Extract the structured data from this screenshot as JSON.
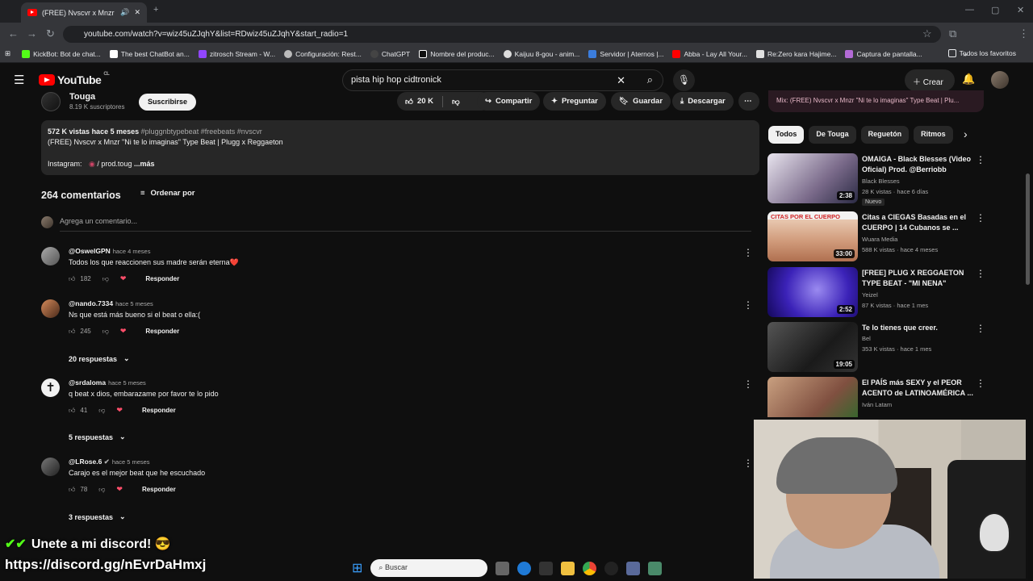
{
  "browser": {
    "tab_title": "(FREE) Nvscvr x Mnzr \"Ni te",
    "url": "youtube.com/watch?v=wiz45uZJqhY&list=RDwiz45uZJqhY&start_radio=1",
    "bookmarks": [
      "KickBot: Bot de chat...",
      "The best ChatBot an...",
      "zitrosch Stream - W...",
      "Configuración: Rest...",
      "ChatGPT",
      "Nombre del produc...",
      "Kaijuu 8-gou - anim...",
      "Servidor | Aternos |...",
      "Abba - Lay All Your...",
      "Re:Zero kara Hajime...",
      "Captura de pantalla..."
    ],
    "all_bookmarks": "Todos los favoritos"
  },
  "header": {
    "logo": "YouTube",
    "country": "CL",
    "search_value": "pista hip hop cidtronick",
    "create": "Crear"
  },
  "channel": {
    "name": "Touga",
    "subscribers": "8.19 K suscriptores",
    "subscribe": "Suscribirse"
  },
  "actions": {
    "likes": "20 K",
    "share": "Compartir",
    "ask": "Preguntar",
    "save": "Guardar",
    "download": "Descargar"
  },
  "description": {
    "views": "572 K vistas",
    "age": "hace 5 meses",
    "tags": "#pluggnbtypebeat #freebeats #nvscvr",
    "title": "(FREE) Nvscvr x Mnzr \"Ni te lo imaginas\" Type Beat | Plugg x Reggaeton",
    "instagram_label": "Instagram:",
    "instagram_value": "/ prod.toug",
    "more": "...más"
  },
  "comments": {
    "count": "264 comentarios",
    "sort": "Ordenar por",
    "add_placeholder": "Agrega un comentario...",
    "reply_label": "Responder",
    "items": [
      {
        "user": "@OswelGPN",
        "time": "hace 4 meses",
        "text": "Todos los que reaccionen sus madre serán eterna❤️",
        "likes": "182"
      },
      {
        "user": "@nando.7334",
        "time": "hace 5 meses",
        "text": "Ns que está más bueno si el beat o ella:(",
        "likes": "245",
        "replies": "20 respuestas"
      },
      {
        "user": "@srdaloma",
        "time": "hace 5 meses",
        "text": "q beat x dios, embarazame por favor te lo pido",
        "likes": "41",
        "replies": "5 respuestas"
      },
      {
        "user": "@LRose.6",
        "time": "hace 5 meses",
        "text": "Carajo es el mejor beat que he escuchado",
        "likes": "78",
        "replies": "3 respuestas"
      }
    ]
  },
  "sidebar": {
    "mix": "Mix: (FREE) Nvscvr x Mnzr \"Ni te lo imaginas\" Type Beat | Plu...",
    "chips": [
      "Todos",
      "De Touga",
      "Reguetón",
      "Ritmos"
    ],
    "videos": [
      {
        "title": "OMAIGA - Black Blesses (Video Oficial) Prod. @Berriobb",
        "channel": "Black Blesses",
        "meta": "28 K vistas · hace 6 días",
        "duration": "2:38",
        "badge": "Nuevo"
      },
      {
        "title": "Citas a CIEGAS Basadas en el CUERPO | 14 Cubanos se ...",
        "channel": "Wuara Media",
        "meta": "588 K vistas · hace 4 meses",
        "duration": "33:00",
        "thumb_text": "CITAS POR EL CUERPO"
      },
      {
        "title": "[FREE] PLUG X REGGAETON TYPE BEAT - \"MI NENA\"",
        "channel": "Yeizel",
        "meta": "87 K vistas · hace 1 mes",
        "duration": "2:52"
      },
      {
        "title": "Te lo tienes que creer.",
        "channel": "Bel",
        "meta": "353 K vistas · hace 1 mes",
        "duration": "19:05"
      },
      {
        "title": "El PAÍS más SEXY y el PEOR ACENTO de LATINOAMÉRICA ...",
        "channel": "Iván Latam",
        "meta": "",
        "duration": ""
      }
    ]
  },
  "overlay": {
    "discord_text": "Unete a mi discord!",
    "discord_link": "https://discord.gg/nEvrDaHmxj"
  },
  "taskbar": {
    "search": "Buscar"
  }
}
